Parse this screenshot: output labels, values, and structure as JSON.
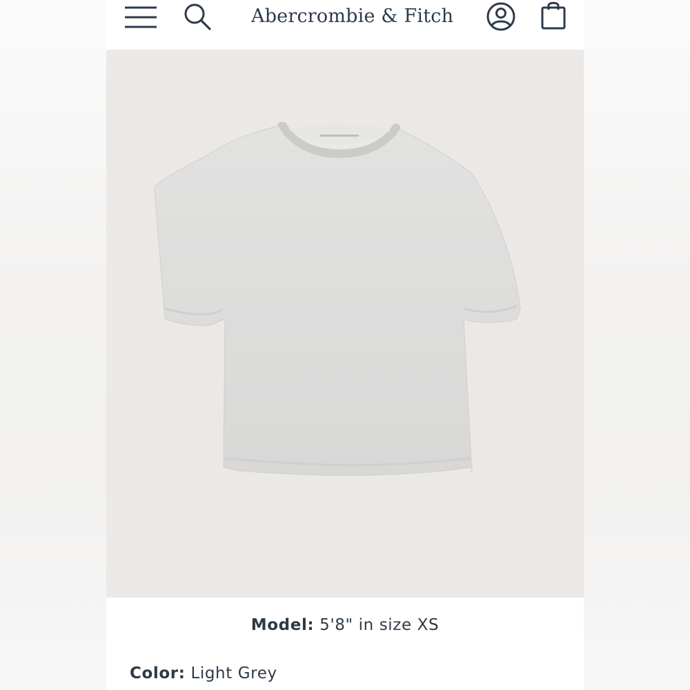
{
  "header": {
    "brand": "Abercrombie & Fitch",
    "icons": [
      "menu-icon",
      "search-icon",
      "account-icon",
      "shopping-bag-icon"
    ]
  },
  "product": {
    "image_alt": "Light grey heather short-sleeve baby tee",
    "model_label": "Model:",
    "model_value": "5'8\" in size XS",
    "color_label": "Color:",
    "color_value": "Light Grey"
  },
  "colors": {
    "brand_navy": "#2c3a4a",
    "hero_bg": "#ebe8e6",
    "shirt": "#dcdcdb"
  }
}
